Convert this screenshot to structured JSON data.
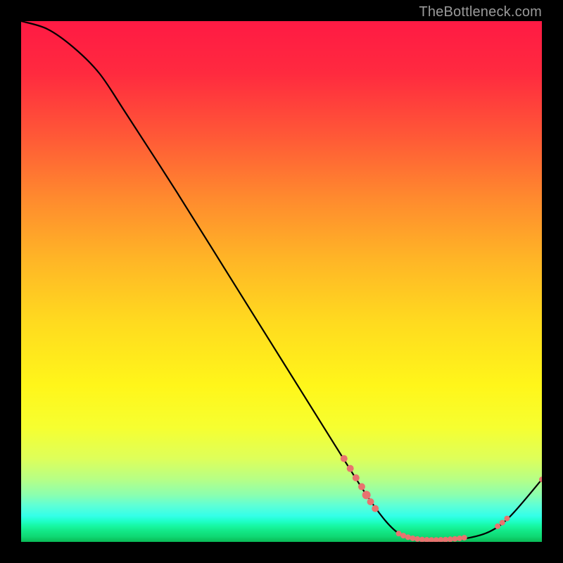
{
  "attribution": "TheBottleneck.com",
  "chart_data": {
    "type": "line",
    "title": "",
    "xlabel": "",
    "ylabel": "",
    "xlim": [
      0,
      100
    ],
    "ylim": [
      0,
      100
    ],
    "curve_points": [
      {
        "x": 0.0,
        "y": 100.0
      },
      {
        "x": 5.0,
        "y": 98.5
      },
      {
        "x": 10.0,
        "y": 95.0
      },
      {
        "x": 15.0,
        "y": 90.0
      },
      {
        "x": 20.0,
        "y": 82.5
      },
      {
        "x": 30.0,
        "y": 67.0
      },
      {
        "x": 40.0,
        "y": 51.0
      },
      {
        "x": 50.0,
        "y": 35.0
      },
      {
        "x": 60.0,
        "y": 19.0
      },
      {
        "x": 66.0,
        "y": 9.5
      },
      {
        "x": 70.0,
        "y": 4.0
      },
      {
        "x": 73.0,
        "y": 1.3
      },
      {
        "x": 76.0,
        "y": 0.5
      },
      {
        "x": 80.0,
        "y": 0.4
      },
      {
        "x": 85.0,
        "y": 0.6
      },
      {
        "x": 90.0,
        "y": 2.0
      },
      {
        "x": 94.0,
        "y": 5.0
      },
      {
        "x": 100.0,
        "y": 12.0
      }
    ],
    "marker_points": [
      {
        "x": 62.0,
        "y": 16.0,
        "r": 5
      },
      {
        "x": 63.2,
        "y": 14.1,
        "r": 5
      },
      {
        "x": 64.3,
        "y": 12.3,
        "r": 5
      },
      {
        "x": 65.4,
        "y": 10.6,
        "r": 5
      },
      {
        "x": 66.3,
        "y": 9.0,
        "r": 6
      },
      {
        "x": 67.1,
        "y": 7.7,
        "r": 5
      },
      {
        "x": 68.0,
        "y": 6.4,
        "r": 5
      },
      {
        "x": 72.5,
        "y": 1.6,
        "r": 4
      },
      {
        "x": 73.4,
        "y": 1.2,
        "r": 4
      },
      {
        "x": 74.3,
        "y": 0.9,
        "r": 4
      },
      {
        "x": 75.2,
        "y": 0.7,
        "r": 4
      },
      {
        "x": 76.1,
        "y": 0.55,
        "r": 4
      },
      {
        "x": 77.0,
        "y": 0.45,
        "r": 4
      },
      {
        "x": 77.9,
        "y": 0.4,
        "r": 4
      },
      {
        "x": 78.8,
        "y": 0.38,
        "r": 4
      },
      {
        "x": 79.7,
        "y": 0.38,
        "r": 4
      },
      {
        "x": 80.6,
        "y": 0.4,
        "r": 4
      },
      {
        "x": 81.5,
        "y": 0.44,
        "r": 4
      },
      {
        "x": 82.4,
        "y": 0.5,
        "r": 4
      },
      {
        "x": 83.3,
        "y": 0.58,
        "r": 4
      },
      {
        "x": 84.2,
        "y": 0.68,
        "r": 4
      },
      {
        "x": 85.1,
        "y": 0.8,
        "r": 4
      },
      {
        "x": 91.5,
        "y": 3.0,
        "r": 4
      },
      {
        "x": 92.4,
        "y": 3.7,
        "r": 4
      },
      {
        "x": 93.3,
        "y": 4.5,
        "r": 4
      },
      {
        "x": 100.0,
        "y": 12.0,
        "r": 4
      }
    ],
    "background_gradient": {
      "direction": "top-to-bottom",
      "stops": [
        {
          "pos": 0.0,
          "color": "#ff1a44"
        },
        {
          "pos": 0.5,
          "color": "#ffcc22"
        },
        {
          "pos": 0.78,
          "color": "#f0ff40"
        },
        {
          "pos": 1.0,
          "color": "#0abb58"
        }
      ]
    }
  }
}
